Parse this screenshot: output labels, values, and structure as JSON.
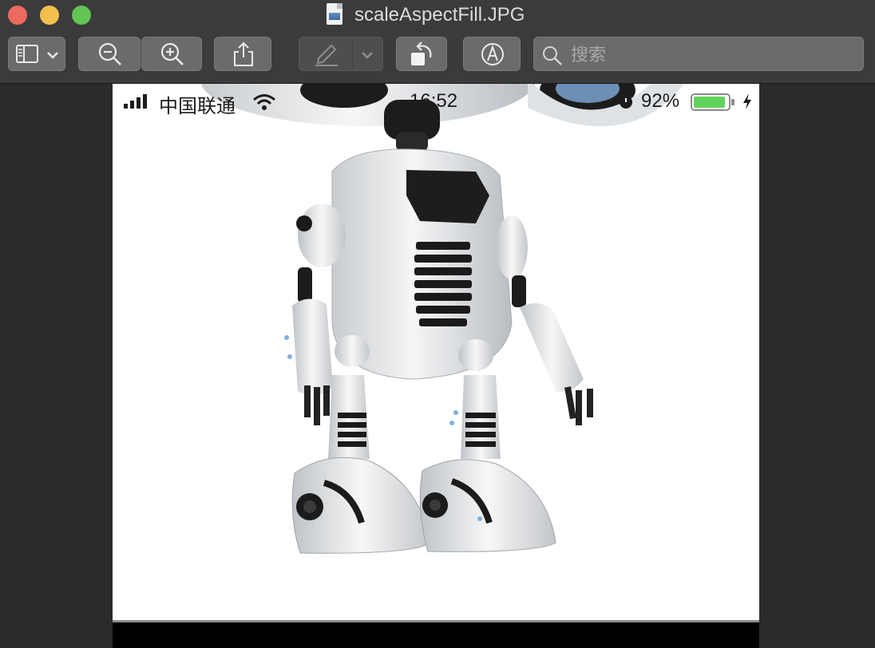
{
  "window": {
    "title": "scaleAspectFill.JPG"
  },
  "toolbar": {
    "sidebar_icon": "sidebar-icon",
    "zoom_out_icon": "zoom-out-icon",
    "zoom_in_icon": "zoom-in-icon",
    "share_icon": "share-icon",
    "markup_icon": "pen-markup-icon",
    "rotate_icon": "rotate-left-icon",
    "annotate_icon": "annotate-pen-circle-icon"
  },
  "search": {
    "placeholder": "搜索",
    "value": ""
  },
  "photo": {
    "status_bar": {
      "carrier": "中国联通",
      "time": "16:52",
      "battery": "92%",
      "battery_level": 0.92
    },
    "subject": "white-robot-image"
  },
  "colors": {
    "close": "#ed6a5e",
    "minimize": "#f4bf4f",
    "maximize": "#61c554",
    "battery_fill": "#5fd35b"
  }
}
